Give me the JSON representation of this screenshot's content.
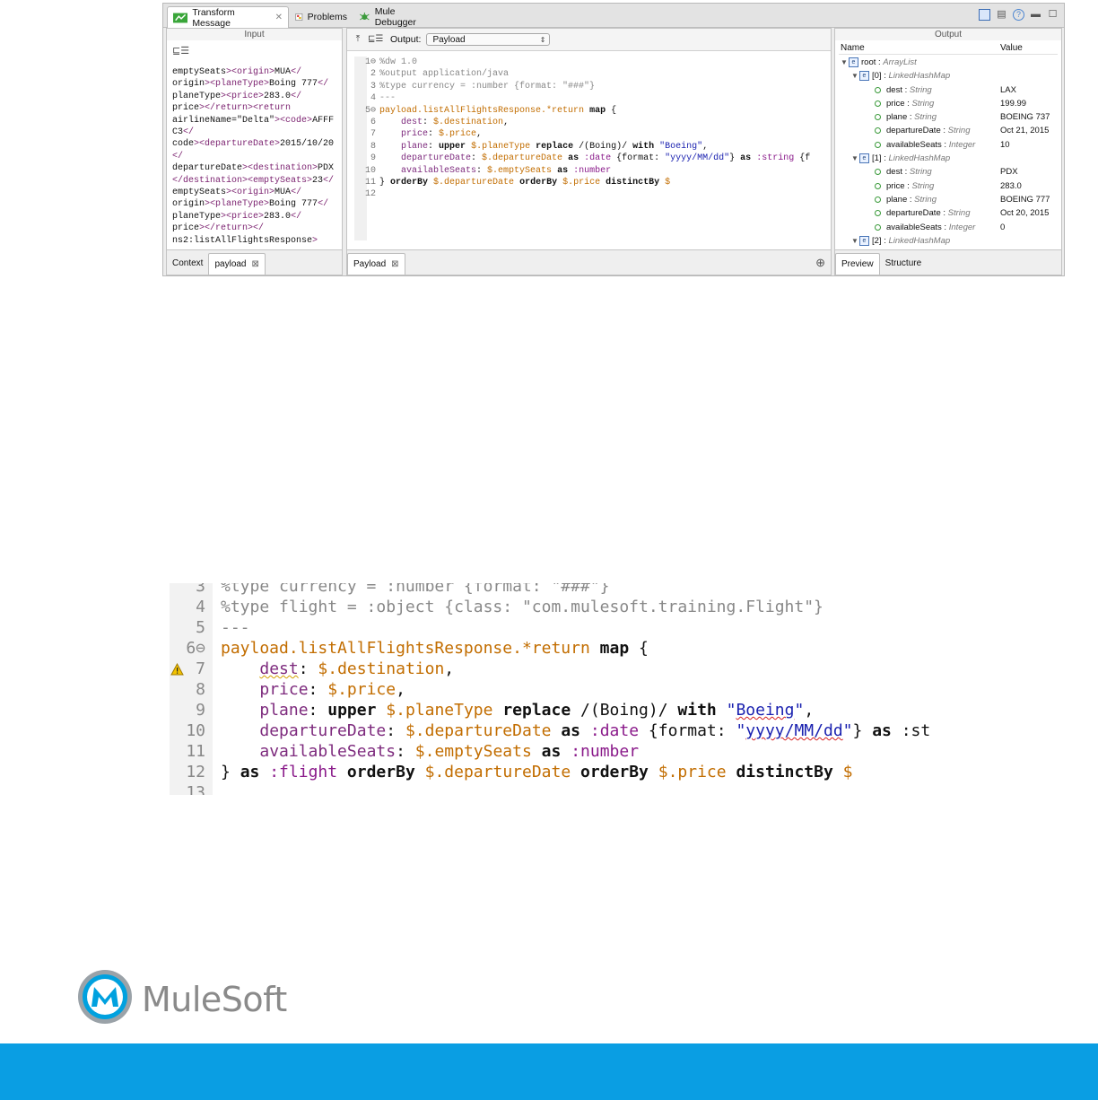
{
  "studio": {
    "tabs": [
      {
        "label": "Transform Message"
      },
      {
        "label": "Problems"
      },
      {
        "label": "Mule Debugger"
      }
    ],
    "input_pane": {
      "header": "Input",
      "lines": [
        "emptySeats><origin>MUA</",
        "origin><planeType>Boing 777</",
        "planeType><price>283.0</",
        "price></return><return",
        "airlineName=\"Delta\"><code>AFFF",
        "C3</",
        "code><departureDate>2015/10/20",
        "</",
        "departureDate><destination>PDX",
        "</destination><emptySeats>23</",
        "emptySeats><origin>MUA</",
        "origin><planeType>Boing 777</",
        "planeType><price>283.0</",
        "price></return></",
        "ns2:listAllFlightsResponse>"
      ],
      "footer_tabs": [
        {
          "label": "Context"
        },
        {
          "label": "payload"
        }
      ]
    },
    "script_pane": {
      "output_label": "Output:",
      "output_value": "Payload",
      "footer_tab": "Payload",
      "code": [
        {
          "n": "1",
          "t": "%dw 1.0"
        },
        {
          "n": "2",
          "t": "%output application/java"
        },
        {
          "n": "3",
          "t": "%type currency = :number {format: \"###\"}"
        },
        {
          "n": "4",
          "t": "---"
        },
        {
          "n": "5",
          "t": "payload.listAllFlightsResponse.*return map {"
        },
        {
          "n": "6",
          "t": "dest: $.destination,"
        },
        {
          "n": "7",
          "t": "price: $.price,"
        },
        {
          "n": "8",
          "t": "plane: upper $.planeType replace /(Boing)/ with \"Boeing\","
        },
        {
          "n": "9",
          "t": "departureDate: $.departureDate as :date {format: \"yyyy/MM/dd\"} as :string {f"
        },
        {
          "n": "10",
          "t": "availableSeats: $.emptySeats as :number"
        },
        {
          "n": "11",
          "t": "} orderBy $.departureDate orderBy $.price distinctBy $"
        },
        {
          "n": "12",
          "t": ""
        }
      ]
    },
    "output_pane": {
      "header": "Output",
      "col_name": "Name",
      "col_value": "Value",
      "root": {
        "name": "root",
        "type": "ArrayList"
      },
      "items": [
        {
          "name": "[0]",
          "type": "LinkedHashMap",
          "fields": [
            {
              "k": "dest",
              "t": "String",
              "v": "LAX"
            },
            {
              "k": "price",
              "t": "String",
              "v": "199.99"
            },
            {
              "k": "plane",
              "t": "String",
              "v": "BOEING 737"
            },
            {
              "k": "departureDate",
              "t": "String",
              "v": "Oct 21, 2015"
            },
            {
              "k": "availableSeats",
              "t": "Integer",
              "v": "10"
            }
          ]
        },
        {
          "name": "[1]",
          "type": "LinkedHashMap",
          "fields": [
            {
              "k": "dest",
              "t": "String",
              "v": "PDX"
            },
            {
              "k": "price",
              "t": "String",
              "v": "283.0"
            },
            {
              "k": "plane",
              "t": "String",
              "v": "BOEING 777"
            },
            {
              "k": "departureDate",
              "t": "String",
              "v": "Oct 20, 2015"
            },
            {
              "k": "availableSeats",
              "t": "Integer",
              "v": "0"
            }
          ]
        },
        {
          "name": "[2]",
          "type": "LinkedHashMap",
          "fields": []
        }
      ],
      "footer_tabs": [
        {
          "label": "Preview"
        },
        {
          "label": "Structure"
        }
      ]
    }
  },
  "zoom_snippet": {
    "lines": [
      {
        "n": "3",
        "t": "%type currency = :number {format: \"###\"}"
      },
      {
        "n": "4",
        "t": "%type flight = :object {class: \"com.mulesoft.training.Flight\"}"
      },
      {
        "n": "5",
        "t": "---"
      },
      {
        "n": "6",
        "t": "payload.listAllFlightsResponse.*return map {"
      },
      {
        "n": "7",
        "t": "dest: $.destination,"
      },
      {
        "n": "8",
        "t": "price: $.price,"
      },
      {
        "n": "9",
        "t": "plane: upper $.planeType replace /(Boing)/ with \"Boeing\","
      },
      {
        "n": "10",
        "t": "departureDate: $.departureDate as :date {format: \"yyyy/MM/dd\"} as :stri"
      },
      {
        "n": "11",
        "t": "availableSeats: $.emptySeats as :number"
      },
      {
        "n": "12",
        "t": "} as :flight orderBy $.departureDate orderBy $.price distinctBy $"
      },
      {
        "n": "13",
        "t": ""
      }
    ]
  },
  "brand": {
    "name": "MuleSoft"
  },
  "colors": {
    "accent_blue": "#0a9ee3"
  }
}
